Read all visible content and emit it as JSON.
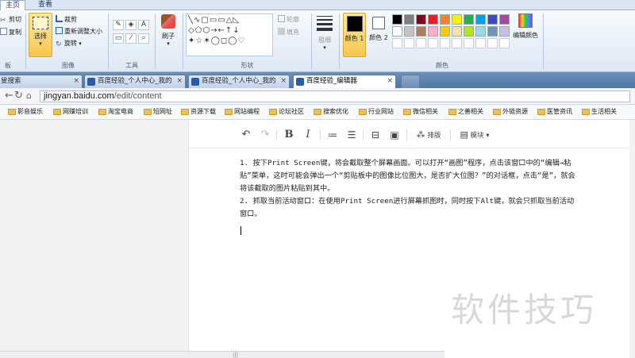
{
  "ribbon": {
    "tabs": [
      "主页",
      "查看"
    ],
    "clipboard": {
      "cut": "剪切",
      "copy": "复制",
      "label": "板"
    },
    "image": {
      "select": "选择",
      "crop": "裁剪",
      "resize": "重新调整大小",
      "rotate": "旋转",
      "label": "图像"
    },
    "tools": {
      "label": "工具"
    },
    "brushes": {
      "label": "刷子"
    },
    "shapes": {
      "outline": "轮廓",
      "fill": "填充",
      "label": "形状"
    },
    "size": {
      "label": "粗细"
    },
    "colors": {
      "color1": "颜色 1",
      "color2": "颜色 2",
      "edit": "编辑颜色",
      "label": "颜色",
      "palette": [
        "#000000",
        "#7f7f7f",
        "#880015",
        "#ed1c24",
        "#ff7f27",
        "#fff200",
        "#22b14c",
        "#00a2e8",
        "#3f48cc",
        "#a349a4",
        "#ffffff",
        "#c3c3c3",
        "#b97a57",
        "#ffaec9",
        "#ffc90e",
        "#efe4b0",
        "#b5e61d",
        "#99d9ea",
        "#7092be",
        "#c8bfe7"
      ]
    }
  },
  "browser": {
    "tabs": [
      {
        "title": "叟搜索",
        "active": false
      },
      {
        "title": "百度经验_个人中心_我的",
        "active": false
      },
      {
        "title": "百度经验_个人中心_我的",
        "active": false
      },
      {
        "title": "百度经验_编辑器",
        "active": true
      }
    ],
    "url": {
      "host": "jingyan.baidu.com",
      "path": "/edit/content"
    },
    "bookmarks": [
      "影音娱乐",
      "网赚培训",
      "淘宝电商",
      "短网址",
      "资源下载",
      "网站编程",
      "论坛社区",
      "搜索优化",
      "行业网站",
      "微信相关",
      "之善相关",
      "外链资源",
      "医管资讯",
      "生活相关"
    ]
  },
  "editor": {
    "toolbar": {
      "layout": "排版",
      "module": "模块"
    },
    "paragraphs": [
      "1. 按下Print Screen键，将会截取整个屏幕画面。可以打开“画图”程序，点击该窗口中的“编辑→粘贴”菜单，这时可能会弹出一个“剪贴板中的图像比位图大，是否扩大位图？”的对话框，点击“是”，就会将该截取的图片粘贴到其中。",
      "2. 抓取当前活动窗口：在使用Print Screen进行屏幕抓图时，同时按下Alt键，就会只抓取当前活动窗口。"
    ]
  },
  "watermark": "软件技巧"
}
